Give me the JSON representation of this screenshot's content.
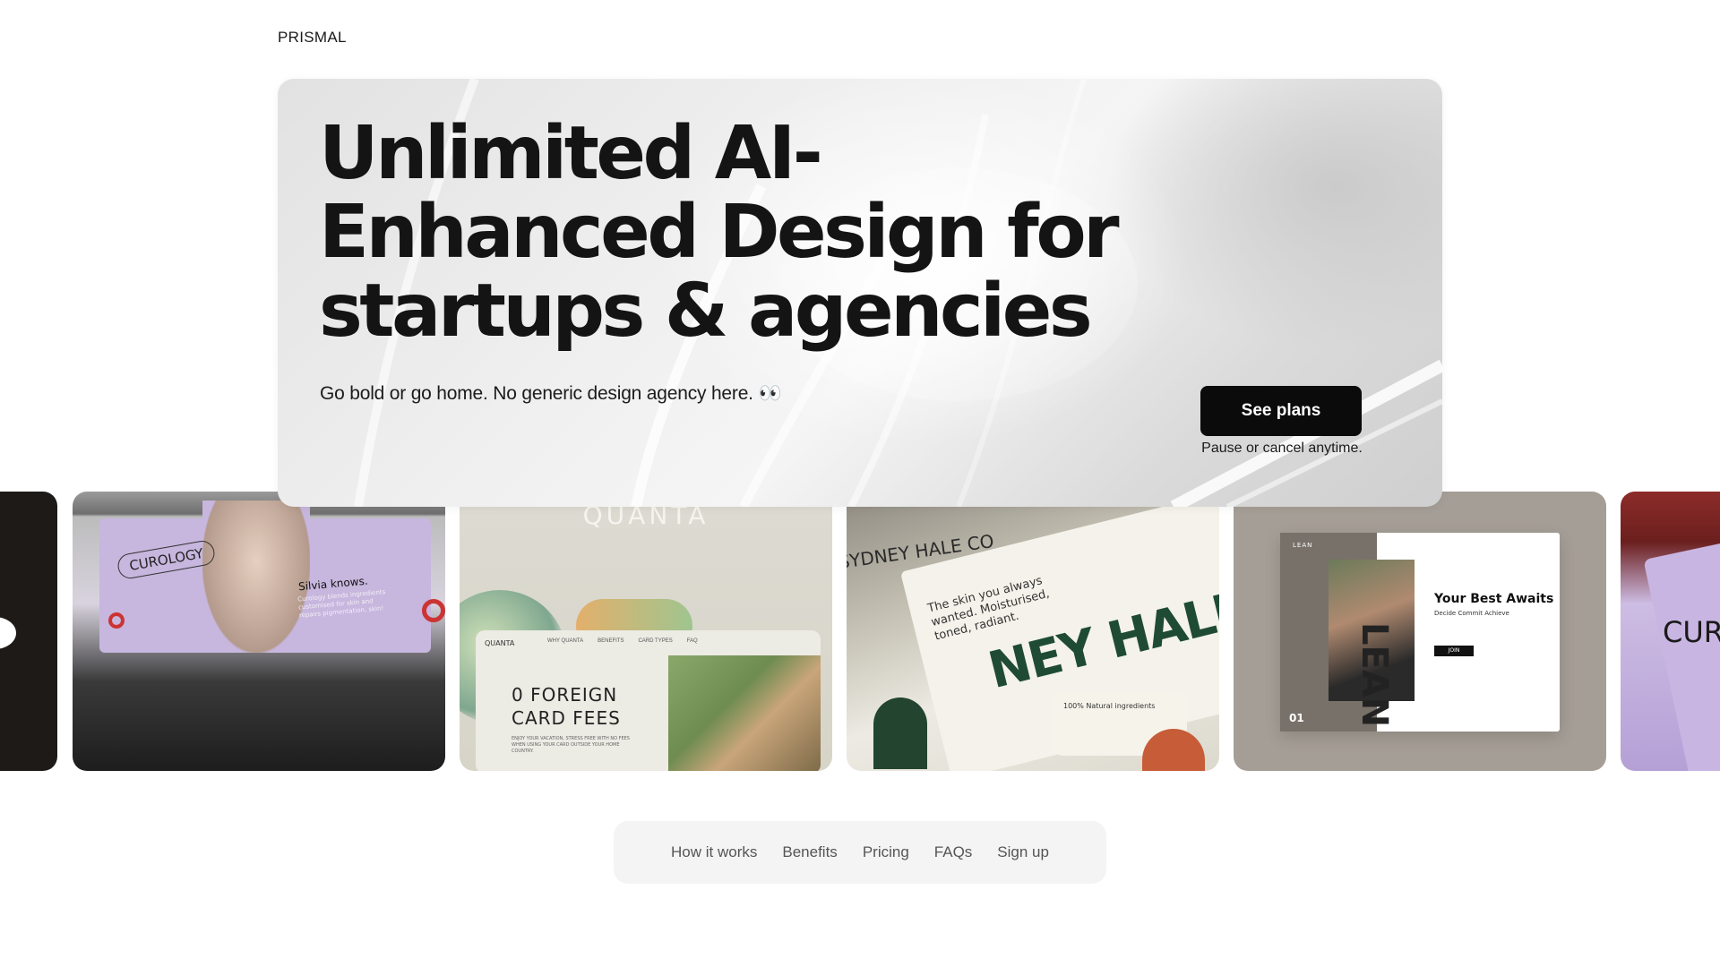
{
  "brand": {
    "logo": "PRISMAL"
  },
  "hero": {
    "title": "Unlimited AI-Enhanced Design for startups & agencies",
    "subtitle": "Go bold or go home. No generic design agency here. 👀",
    "cta_label": "See plans",
    "cta_note": "Pause or cancel anytime."
  },
  "gallery": {
    "curology": {
      "brand": "CUROLOGY",
      "headline": "Silvia knows.",
      "body": "Curology blends ingredients customised for skin and repairs pigmentation, skin!"
    },
    "quanta": {
      "brand": "QUANTA",
      "nav_logo": "QUANTA",
      "nav_items": [
        "WHY QUANTA",
        "BENEFITS",
        "CARD TYPES",
        "FAQ"
      ],
      "headline_line1": "0 FOREIGN",
      "headline_line2": "CARD FEES",
      "body": "ENJOY YOUR VACATION, STRESS FREE WITH NO FEES WHEN USING YOUR CARD OUTSIDE YOUR HOME COUNTRY."
    },
    "sydney": {
      "brand": "SYDNEY HALE CO",
      "tagline": "The skin you always wanted. Moisturised, toned, radiant.",
      "big_text": "NEY HALE",
      "ingredients": "100% Natural ingredients"
    },
    "lean": {
      "brand": "LEAN",
      "vertical": "LEAN",
      "headline": "Your Best Awaits",
      "subhead": "Decide Commit Achieve",
      "button": "JOIN",
      "number": "01"
    },
    "partial_right": {
      "brand": "CUR"
    }
  },
  "nav": {
    "items": [
      "How it works",
      "Benefits",
      "Pricing",
      "FAQs",
      "Sign up"
    ]
  }
}
